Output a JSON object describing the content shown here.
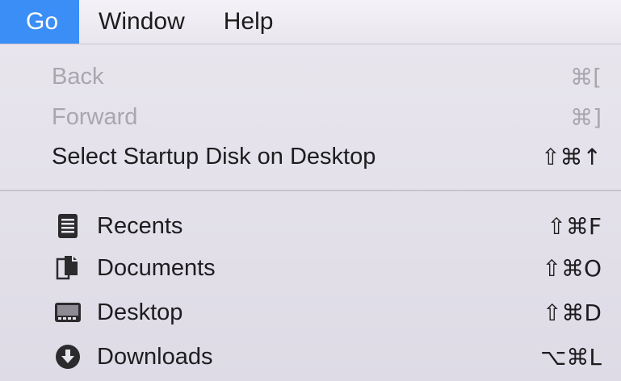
{
  "menubar": {
    "items": [
      {
        "label": "Go",
        "active": true
      },
      {
        "label": "Window",
        "active": false
      },
      {
        "label": "Help",
        "active": false
      }
    ]
  },
  "menu": {
    "items": [
      {
        "label": "Back",
        "shortcut": "⌘[",
        "enabled": false
      },
      {
        "label": "Forward",
        "shortcut": "⌘]",
        "enabled": false
      },
      {
        "label": "Select Startup Disk on Desktop",
        "shortcut": "⇧⌘↑",
        "enabled": true
      },
      {
        "label": "Recents",
        "shortcut": "⇧⌘F",
        "enabled": true,
        "icon": "recents-icon"
      },
      {
        "label": "Documents",
        "shortcut": "⇧⌘O",
        "enabled": true,
        "icon": "documents-icon"
      },
      {
        "label": "Desktop",
        "shortcut": "⇧⌘D",
        "enabled": true,
        "icon": "desktop-icon"
      },
      {
        "label": "Downloads",
        "shortcut": "⌥⌘L",
        "enabled": true,
        "icon": "downloads-icon"
      }
    ]
  },
  "colors": {
    "accent": "#3a8ef5",
    "disabled_text": "#a9a6ae",
    "text": "#1d1d1f"
  }
}
